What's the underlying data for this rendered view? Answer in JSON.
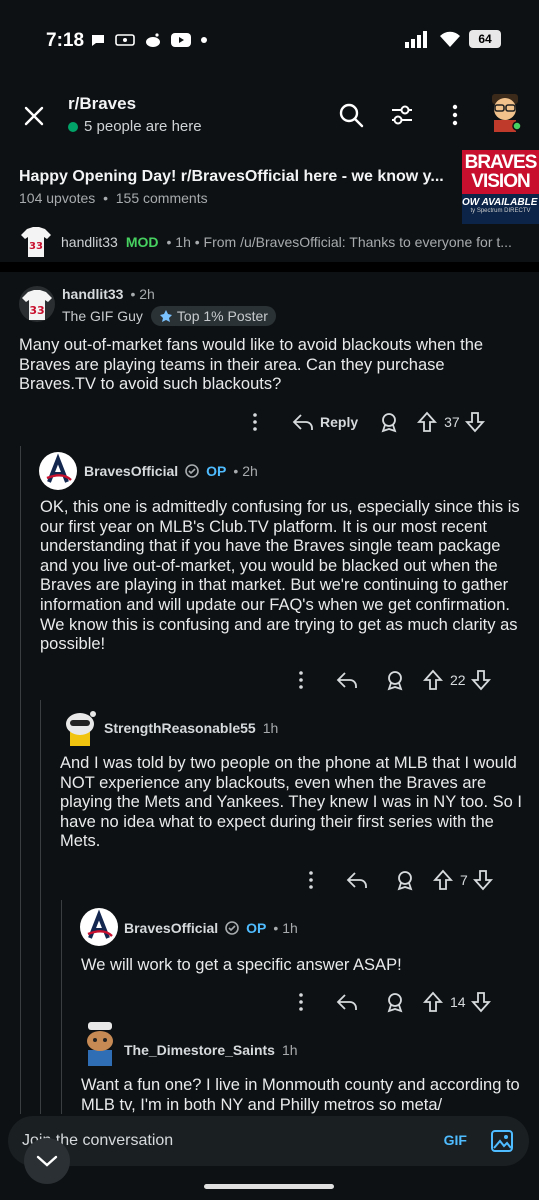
{
  "status_bar": {
    "time": "7:18",
    "battery": "64"
  },
  "nav": {
    "subreddit": "r/Braves",
    "presence": "5 people are here"
  },
  "post": {
    "title": "Happy Opening Day! r/BravesOfficial here - we know y...",
    "upvotes": "104 upvotes",
    "separator": "•",
    "comments": "155 comments",
    "thumbnail": {
      "line1": "BRAVES",
      "line2": "VISION",
      "line3": "OW AVAILABLE O",
      "line4": "ty Spectrum DIRECTV"
    }
  },
  "pinned_comment": {
    "user": "handlit33",
    "badge": "MOD",
    "meta": "• 1h • From /u/BravesOfficial: Thanks to everyone for t..."
  },
  "comments": [
    {
      "user": "handlit33",
      "time": "• 2h",
      "flair_text": "The GIF Guy",
      "flair_badge": "Top 1% Poster",
      "body": "Many out-of-market fans would like to avoid blackouts when the Braves are playing teams in their area. Can they purchase Braves.TV to avoid such blackouts?",
      "reply_label": "Reply",
      "score": "37"
    },
    {
      "user": "BravesOfficial",
      "op": "OP",
      "time": "• 2h",
      "body": "OK, this one is admittedly confusing for us, especially since this is our first year on MLB's Club.TV platform. It is our most recent understanding that if you have the Braves single team package and you live out-of-market, you would be blacked out when the Braves are playing in that market. But we're continuing to gather information and will update our FAQ's when we get confirmation. We know this is confusing and are trying to get as much clarity as possible!",
      "score": "22"
    },
    {
      "user": "StrengthReasonable55",
      "time": "1h",
      "body": "And I was told by two people on the phone at MLB that I would NOT experience any blackouts, even when the Braves are playing the Mets and Yankees. They knew I was in NY too. So I have no idea what to expect during their first series with the Mets.",
      "score": "7"
    },
    {
      "user": "BravesOfficial",
      "op": "OP",
      "time": "• 1h",
      "body": "We will work to get a specific answer ASAP!",
      "score": "14"
    },
    {
      "user": "The_Dimestore_Saints",
      "time": "1h",
      "body": "Want a fun one? I live in Monmouth county and according to MLB tv, I'm in both NY and Philly metros so meta/"
    }
  ],
  "input": {
    "placeholder": "Join the conversation",
    "gif_label": "GIF"
  },
  "colors": {
    "background": "#0e1113",
    "accent_blue": "#4fbcff",
    "mod_green": "#46d160",
    "online_green": "#01a368"
  }
}
